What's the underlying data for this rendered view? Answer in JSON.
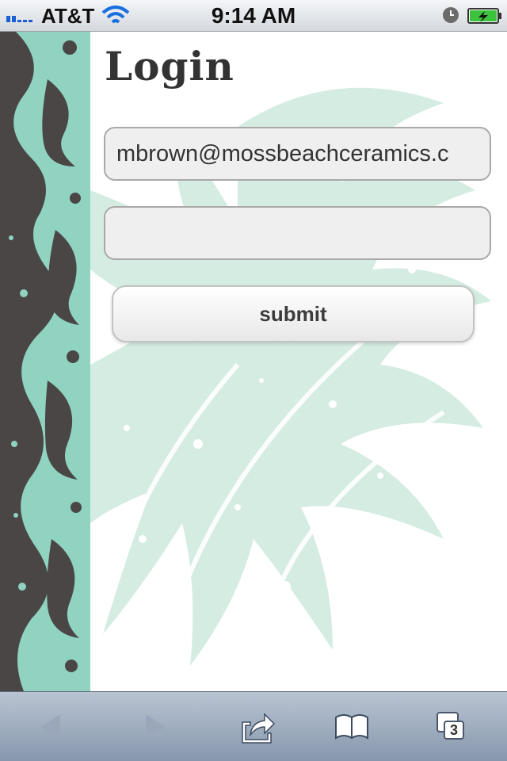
{
  "status_bar": {
    "carrier": "AT&T",
    "time": "9:14 AM"
  },
  "page": {
    "title": "Login"
  },
  "form": {
    "email_value": "mbrown@mossbeachceramics.c",
    "password_value": "",
    "submit_label": "submit"
  },
  "toolbar": {
    "pages_count": "3"
  },
  "colors": {
    "accent_teal": "#8fd3c0",
    "pattern_dark": "#4a4646"
  }
}
